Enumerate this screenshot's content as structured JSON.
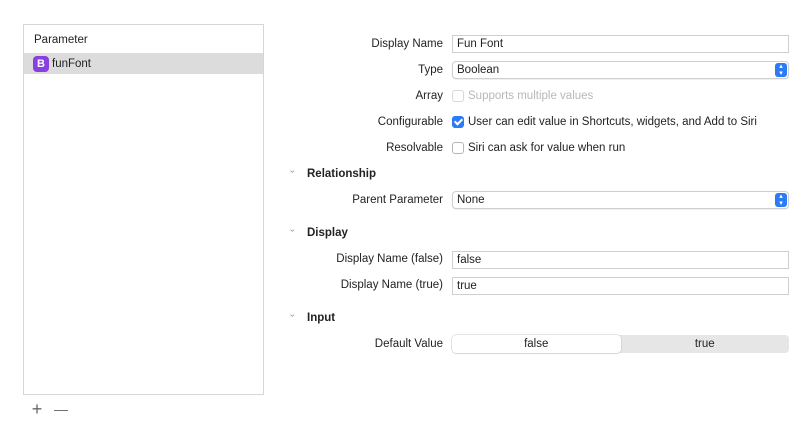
{
  "parameter_list": {
    "header": "Parameter",
    "items": [
      {
        "badge": "B",
        "name": "funFont",
        "selected": true
      }
    ],
    "add_button": "+",
    "remove_button": "—"
  },
  "form": {
    "display_name": {
      "label": "Display Name",
      "value": "Fun Font"
    },
    "type": {
      "label": "Type",
      "value": "Boolean"
    },
    "array": {
      "label": "Array",
      "option": "Supports multiple values",
      "checked": false,
      "disabled": true
    },
    "configurable": {
      "label": "Configurable",
      "option": "User can edit value in Shortcuts, widgets, and Add to Siri",
      "checked": true
    },
    "resolvable": {
      "label": "Resolvable",
      "option": "Siri can ask for value when run",
      "checked": false
    }
  },
  "relationship": {
    "title": "Relationship",
    "parent_parameter": {
      "label": "Parent Parameter",
      "value": "None"
    }
  },
  "display": {
    "title": "Display",
    "name_false": {
      "label": "Display Name (false)",
      "value": "false"
    },
    "name_true": {
      "label": "Display Name (true)",
      "value": "true"
    }
  },
  "input": {
    "title": "Input",
    "default_value": {
      "label": "Default Value",
      "options": [
        "false",
        "true"
      ],
      "selected": "false"
    }
  },
  "colors": {
    "accent": "#2a7bf4",
    "badge": "#8a3fe0",
    "selected_row": "#dcdcdc"
  }
}
